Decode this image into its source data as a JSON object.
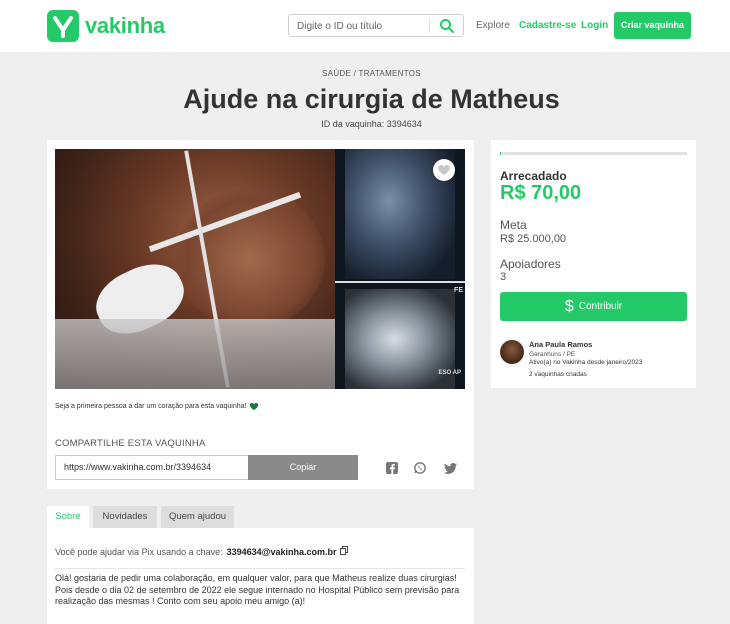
{
  "header": {
    "brand": "vakinha",
    "search_placeholder": "Digite o ID ou título",
    "nav_explore": "Explore",
    "nav_signup": "Cadastre-se",
    "nav_login": "Login",
    "create_button": "Criar vaquinha"
  },
  "campaign": {
    "category": "SAÚDE / TRATAMENTOS",
    "title": "Ajude na cirurgia de Matheus",
    "id_label": "ID da vaquinha: 3394634"
  },
  "media": {
    "heart_prompt": "Seja a primeira pessoa a dar um coração para esta vaquinha!",
    "xray_label_top": "FE",
    "xray_label_bottom": "ESO AP"
  },
  "share": {
    "title": "COMPARTILHE ESTA VAQUINHA",
    "url": "https://www.vakinha.com.br/3394634",
    "copy_label": "Copiar"
  },
  "stats": {
    "progress_fraction": 0.0028,
    "raised_label": "Arrecadado",
    "raised_value": "R$ 70,00",
    "goal_label": "Meta",
    "goal_value": "R$ 25.000,00",
    "supporters_label": "Apoiadores",
    "supporters_value": "3",
    "contribute_label": "Contribuir"
  },
  "organizer": {
    "name": "Ana Paula Ramos",
    "location": "Garanhuns / PE",
    "since": "Ativo(a) no Vakinha desde janeiro/2023",
    "campaigns": "2 vaquinhas criadas"
  },
  "tabs": [
    {
      "label": "Sobre"
    },
    {
      "label": "Novidades"
    },
    {
      "label": "Quem ajudou"
    }
  ],
  "about": {
    "pix_prefix": "Você pode ajudar via Pix usando a chave:",
    "pix_key": "3394634@vakinha.com.br",
    "description": "Olá! gostaria de pedir uma colaboração, em qualquer valor, para que Matheus realize duas cirurgias! Pois desde o dia 02 de setembro de 2022 ele segue internado no Hospital Público sem previsão para realização das mesmas ! Conto com seu apoio meu amigo (a)!"
  },
  "colors": {
    "brand_green": "#24ca68",
    "copy_gray": "#8a8a8a"
  }
}
